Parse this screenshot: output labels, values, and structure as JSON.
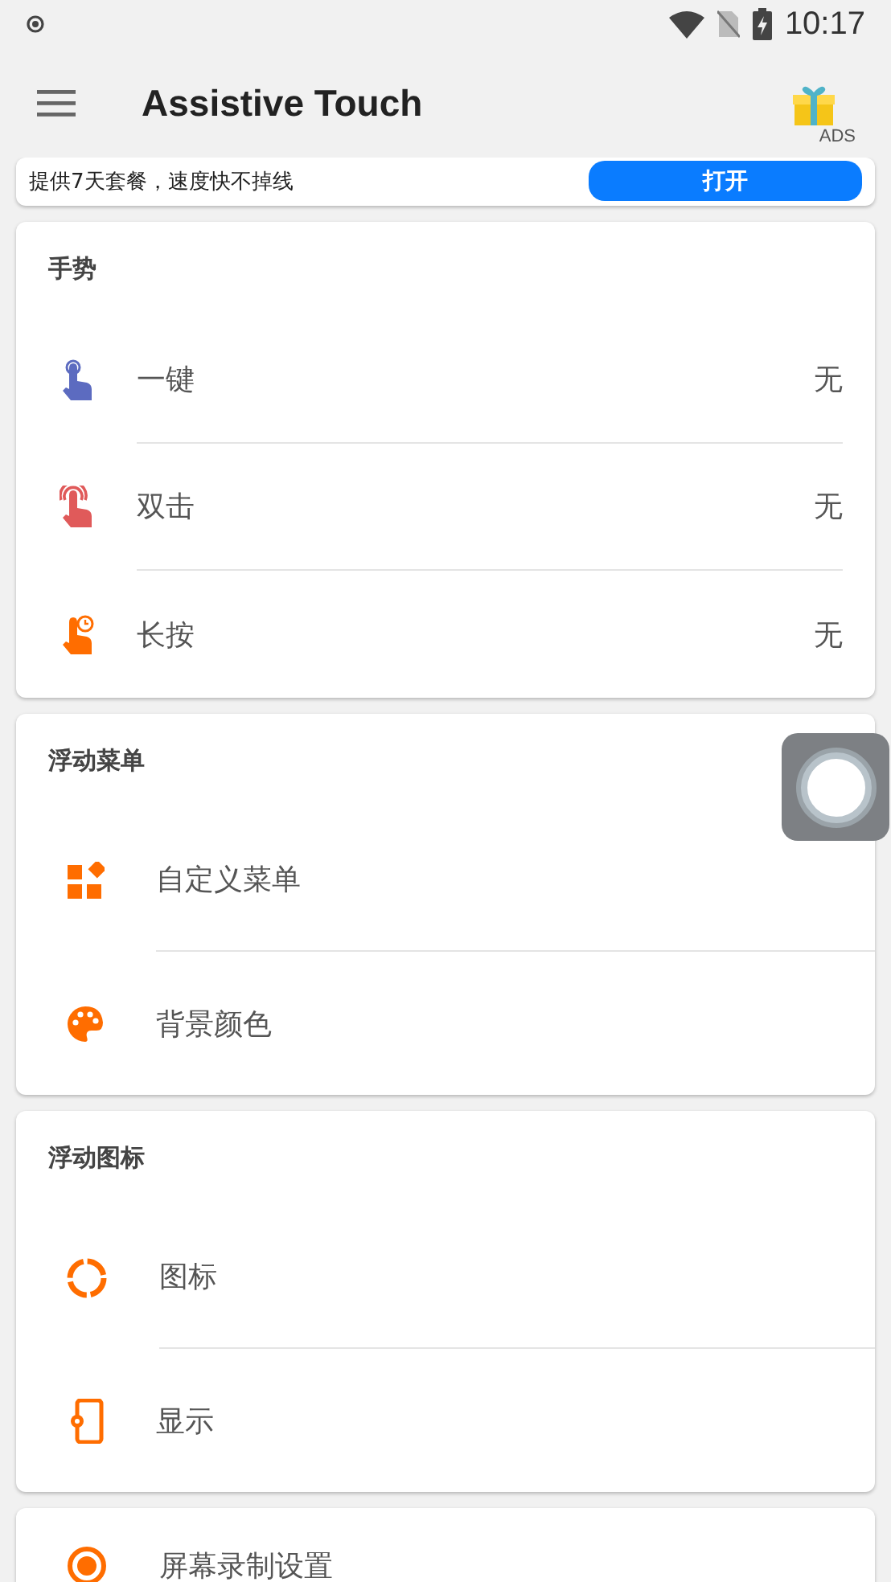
{
  "status_bar": {
    "time": "10:17"
  },
  "app_bar": {
    "title": "Assistive Touch",
    "ads_label": "ADS"
  },
  "ad_banner": {
    "text": "提供7天套餐，速度快不掉线",
    "button": "打开"
  },
  "sections": [
    {
      "title": "手势",
      "items": [
        {
          "kind": "gesture",
          "label": "一键",
          "value": "无",
          "color": "#5c6bc0"
        },
        {
          "kind": "gesture",
          "label": "双击",
          "value": "无",
          "color": "#e05a5a"
        },
        {
          "kind": "gesture",
          "label": "长按",
          "value": "无",
          "color": "#ff6d00"
        }
      ]
    },
    {
      "title": "浮动菜单",
      "items": [
        {
          "kind": "menu",
          "label": "自定义菜单"
        },
        {
          "kind": "menu",
          "label": "背景颜色"
        }
      ]
    },
    {
      "title": "浮动图标",
      "items": [
        {
          "kind": "menu",
          "label": "图标"
        },
        {
          "kind": "menu",
          "label": "显示"
        }
      ]
    },
    {
      "items": [
        {
          "kind": "menu",
          "label": "屏幕录制设置"
        }
      ]
    }
  ]
}
